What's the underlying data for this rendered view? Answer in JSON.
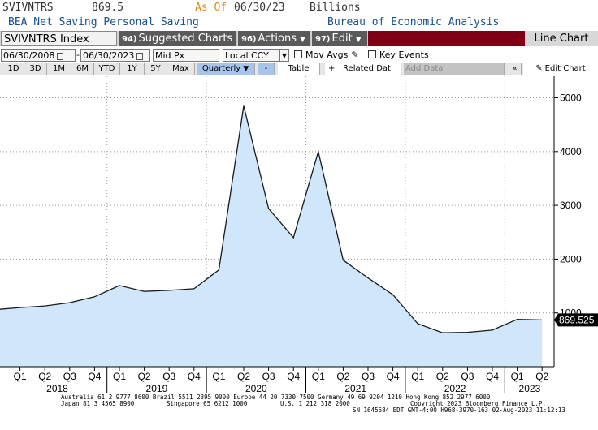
{
  "header": {
    "ticker": "SVIVNTRS",
    "last_value": "869.5",
    "as_of_label": "As Of",
    "as_of_date": "06/30/23",
    "units": "Billions",
    "description": "BEA Net Saving Personal Saving",
    "source": "Bureau of Economic Analysis"
  },
  "toolbar": {
    "security": "SVIVNTRS Index",
    "suggested_num": "94)",
    "suggested_label": "Suggested Charts",
    "actions_num": "96)",
    "actions_label": "Actions",
    "edit_num": "97)",
    "edit_label": "Edit",
    "chart_type": "Line Chart",
    "accent_color": "#7d0015"
  },
  "controls": {
    "start_date": "06/30/2008",
    "end_date": "06/30/2023",
    "field": "Mid Px",
    "currency": "Local CCY",
    "mov_avgs_label": "Mov Avgs",
    "key_events_label": "Key Events"
  },
  "ranges": {
    "buttons": [
      "1D",
      "3D",
      "1M",
      "6M",
      "YTD",
      "1Y",
      "5Y",
      "Max"
    ],
    "frequency": "Quarterly",
    "table_label": "Table",
    "related_label": "Related Dat",
    "add_data_placeholder": "Add Data",
    "edit_chart_label": "Edit Chart"
  },
  "chart_data": {
    "type": "area",
    "x_labels": [
      "Q1",
      "Q2",
      "Q3",
      "Q4",
      "Q1",
      "Q2",
      "Q3",
      "Q4",
      "Q1",
      "Q2",
      "Q3",
      "Q4",
      "Q1",
      "Q2",
      "Q3",
      "Q4",
      "Q1",
      "Q2",
      "Q3",
      "Q4",
      "Q1",
      "Q2"
    ],
    "year_labels": [
      "2018",
      "2019",
      "2020",
      "2021",
      "2022",
      "2023"
    ],
    "series": [
      {
        "x": [
          "2017-Q4",
          "2018-Q1",
          "2018-Q2",
          "2018-Q3",
          "2018-Q4",
          "2019-Q1",
          "2019-Q2",
          "2019-Q3",
          "2019-Q4",
          "2020-Q1",
          "2020-Q2",
          "2020-Q3",
          "2020-Q4",
          "2021-Q1",
          "2021-Q2",
          "2021-Q3",
          "2021-Q4",
          "2022-Q1",
          "2022-Q2",
          "2022-Q3",
          "2022-Q4",
          "2023-Q1",
          "2023-Q2"
        ],
        "values": [
          1060,
          1100,
          1130,
          1190,
          1300,
          1510,
          1400,
          1420,
          1450,
          1800,
          4850,
          2940,
          2400,
          4000,
          1980,
          1650,
          1340,
          800,
          630,
          640,
          680,
          880,
          869.525
        ]
      }
    ],
    "yticks": [
      1000,
      2000,
      3000,
      4000,
      5000
    ],
    "ylim": [
      0,
      5400
    ],
    "last_value_label": "869.525",
    "fill_color": "#cfe6fb",
    "line_color": "#1a1a1a",
    "grid": true
  },
  "footer": {
    "line1": "Australia 61 2 9777 8600 Brazil 5511 2395 9000 Europe 44 20 7330 7500 Germany 49 69 9204 1210 Hong Kong 852 2977 6000",
    "line2a": "Japan 81 3 4565 8900",
    "line2b": "Singapore 65 6212 1000",
    "line2c": "U.S. 1 212 318 2000",
    "line2d": "Copyright 2023 Bloomberg Finance L.P.",
    "line3": "SN 1645584 EDT  GMT-4:00 H968-3970-163 02-Aug-2023 11:12:13"
  }
}
